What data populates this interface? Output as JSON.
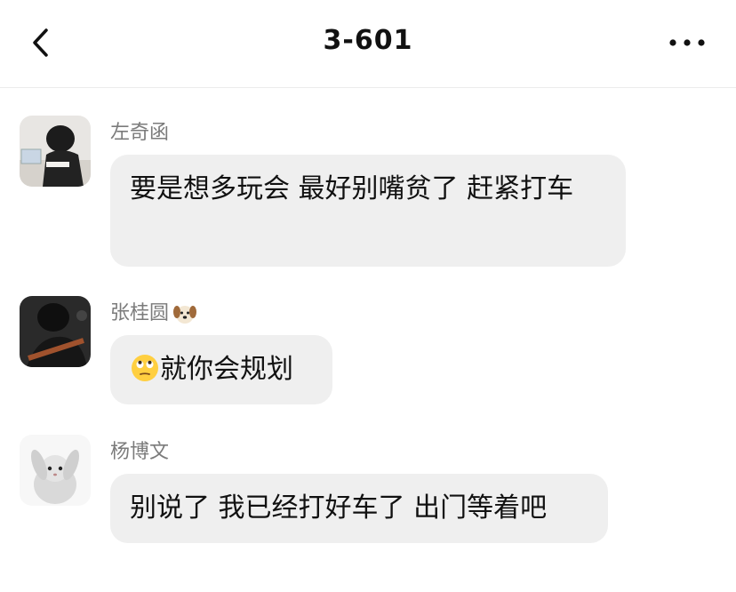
{
  "header": {
    "title": "3-601"
  },
  "messages": [
    {
      "sender": "左奇函",
      "text": "要是想多玩会 最好别嘴贫了 赶紧打车"
    },
    {
      "sender": "张桂圆",
      "sender_badge": "dog-face-emoji",
      "text_emoji": "face-with-rolling-eyes-emoji",
      "text": "就你会规划"
    },
    {
      "sender": "杨博文",
      "text": "别说了 我已经打好车了 出门等着吧"
    }
  ],
  "colors": {
    "bubble": "#efefef",
    "sender_name": "#7b7b7b",
    "text": "#111111"
  }
}
